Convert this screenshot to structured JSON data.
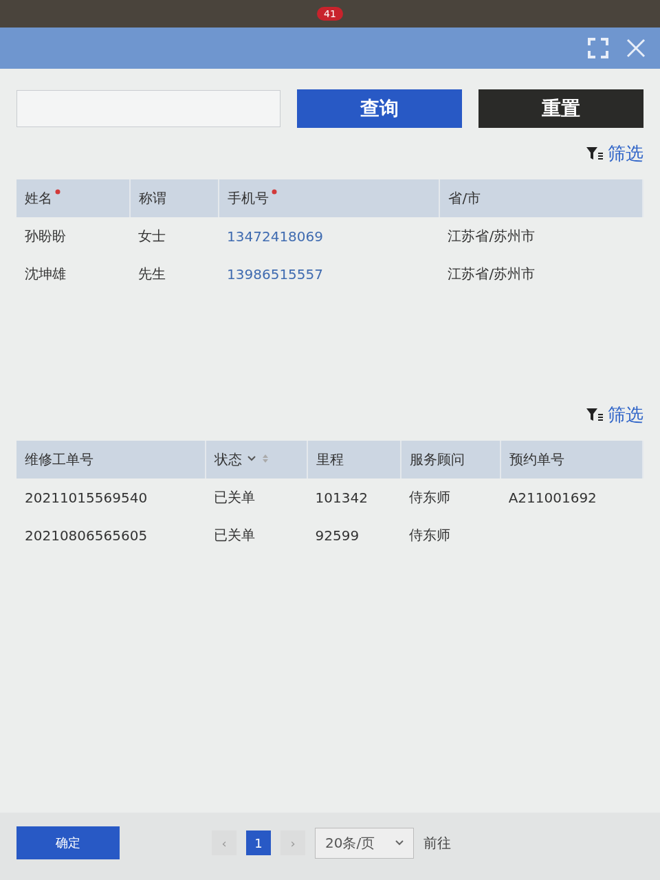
{
  "taskbar": {
    "badge": "41"
  },
  "search": {
    "query_button": "查询",
    "reset_button": "重置",
    "filter_link": "筛选"
  },
  "contacts": {
    "columns": [
      {
        "label": "姓名",
        "required": true
      },
      {
        "label": "称谓",
        "required": false
      },
      {
        "label": "手机号",
        "required": true
      },
      {
        "label": "省/市",
        "required": false
      }
    ],
    "rows": [
      {
        "name": "孙盼盼",
        "title": "女士",
        "phone": "13472418069",
        "region": "江苏省/苏州市"
      },
      {
        "name": "沈坤雄",
        "title": "先生",
        "phone": "13986515557",
        "region": "江苏省/苏州市"
      }
    ]
  },
  "orders": {
    "filter_link": "筛选",
    "columns": [
      {
        "label": "维修工单号",
        "sortable": false
      },
      {
        "label": "状态",
        "sortable": true
      },
      {
        "label": "里程",
        "sortable": false
      },
      {
        "label": "服务顾问",
        "sortable": false
      },
      {
        "label": "预约单号",
        "sortable": false
      }
    ],
    "rows": [
      {
        "cells": [
          "20211015569540",
          "已关单",
          "101342",
          "侍东师",
          "A211001692"
        ]
      },
      {
        "cells": [
          "20210806565605",
          "已关单",
          "92599",
          "侍东师"
        ]
      }
    ]
  },
  "footer": {
    "confirm_button": "确定",
    "prev": "‹",
    "pages": [
      {
        "label": "1",
        "selected": true
      }
    ],
    "next": "›",
    "page_size": "20条/页",
    "goto_label": "前往"
  }
}
